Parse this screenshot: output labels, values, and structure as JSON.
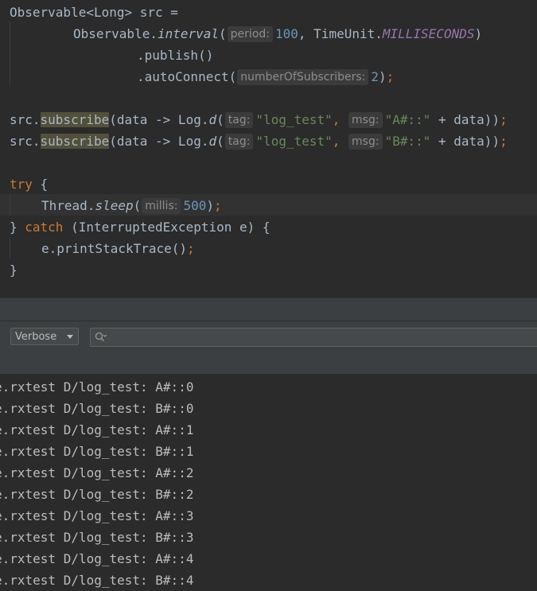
{
  "editor": {
    "l1": "Observable<Long> src =",
    "l2_a": "Observable.",
    "l2_fn": "interval",
    "l2_paren": "(",
    "l2_hint": "period:",
    "l2_num": "100",
    "l2_b": ", TimeUnit.",
    "l2_const": "MILLISECONDS",
    "l2_c": ")",
    "l3": ".publish()",
    "l4_a": ".autoConnect(",
    "l4_hint": "numberOfSubscribers:",
    "l4_num": "2",
    "l4_b": ")",
    "semi": ";",
    "sub_a": "src.",
    "sub_fn": "subscribe",
    "sub_b": "(data -> Log.",
    "sub_d": "d",
    "sub_paren": "(",
    "tag_hint": "tag:",
    "tag_str": "\"log_test\"",
    "comma": ",",
    "msg_hint": "msg:",
    "msg_a": "\"A#::\"",
    "msg_b": "\"B#::\"",
    "sub_end": " + data))",
    "try_kw": "try",
    "brace_open": " {",
    "sleep_a": "Thread.",
    "sleep_fn": "sleep",
    "sleep_paren": "(",
    "sleep_hint": "millis:",
    "sleep_num": "500",
    "sleep_b": ")",
    "catch_a": "} ",
    "catch_kw": "catch",
    "catch_b": " (InterruptedException e) {",
    "print": "e.printStackTrace()",
    "brace_close": "}"
  },
  "logcat": {
    "level": "Verbose",
    "search_placeholder": "",
    "search_icon": "search-icon",
    "lines": [
      "e.rxtest D/log_test: A#::0",
      "e.rxtest D/log_test: B#::0",
      "e.rxtest D/log_test: A#::1",
      "e.rxtest D/log_test: B#::1",
      "e.rxtest D/log_test: A#::2",
      "e.rxtest D/log_test: B#::2",
      "e.rxtest D/log_test: A#::3",
      "e.rxtest D/log_test: B#::3",
      "e.rxtest D/log_test: A#::4",
      "e.rxtest D/log_test: B#::4"
    ]
  }
}
